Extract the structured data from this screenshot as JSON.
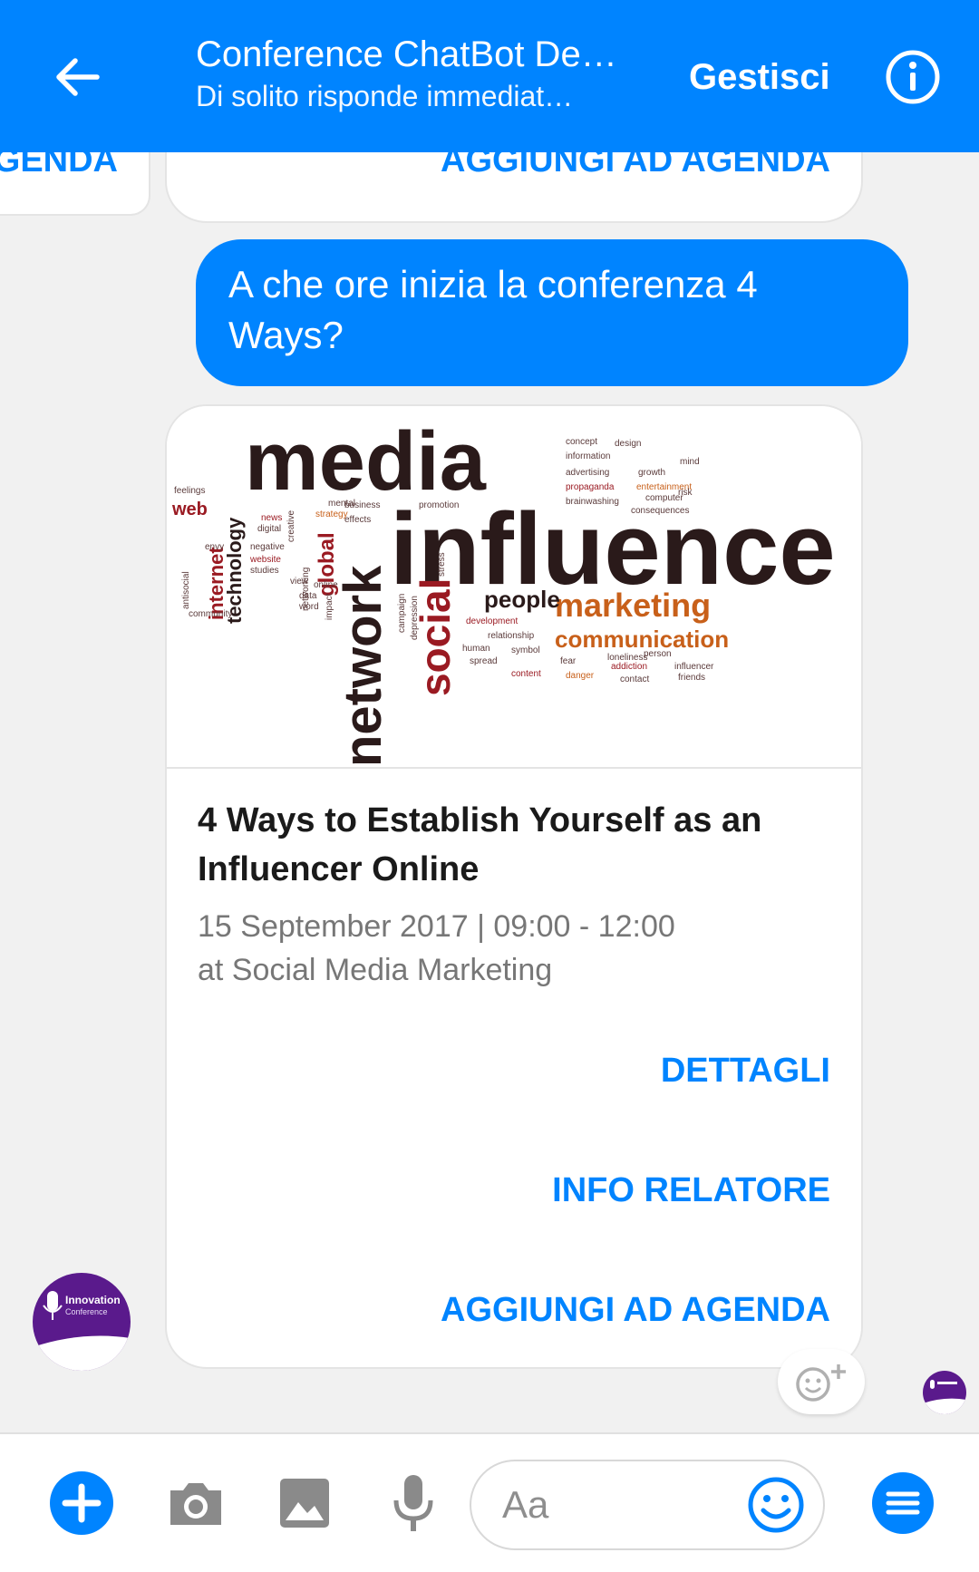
{
  "header": {
    "title": "Conference ChatBot De…",
    "subtitle": "Di solito risponde immediat…",
    "manage_label": "Gestisci"
  },
  "colors": {
    "accent": "#0084ff",
    "avatar_purple": "#5a1a8c"
  },
  "chat": {
    "prev_card_left_button": "GENDA",
    "prev_card_button": "AGGIUNGI AD AGENDA",
    "outgoing_message": "A che ore inizia la conferenza 4 Ways?",
    "card": {
      "image_words": {
        "main": [
          "media",
          "influence",
          "network",
          "social",
          "marketing",
          "communication",
          "people",
          "global",
          "internet",
          "technology",
          "web"
        ],
        "small": [
          "concept",
          "design",
          "information",
          "advertising",
          "growth",
          "propaganda",
          "entertainment",
          "brainwashing",
          "computer",
          "consequences",
          "business",
          "promotion",
          "strategy",
          "feelings",
          "digital",
          "news",
          "negative",
          "website",
          "studies",
          "data",
          "word",
          "online",
          "community",
          "development",
          "relationship",
          "human",
          "symbol",
          "spread",
          "fear",
          "addiction",
          "influencer",
          "content",
          "danger",
          "contact",
          "friends",
          "mind",
          "risk",
          "loneliness",
          "person",
          "view",
          "envy",
          "antisocial",
          "effects",
          "campaign",
          "depression",
          "stress",
          "impact",
          "creative",
          "mental",
          "networking"
        ]
      },
      "title": "4 Ways to Establish Yourself as an Influencer Online",
      "date_line": "15 September 2017 | 09:00 - 12:00",
      "location_line": "at Social Media Marketing",
      "buttons": [
        "DETTAGLI",
        "INFO RELATORE",
        "AGGIUNGI AD AGENDA"
      ]
    },
    "avatar_text": {
      "name": "Innovation",
      "tagline": "Conference"
    }
  },
  "composer": {
    "placeholder": "Aa"
  },
  "icons": {
    "back": "arrow-left-icon",
    "info": "info-icon",
    "add": "plus-icon",
    "camera": "camera-icon",
    "gallery": "image-icon",
    "mic": "microphone-icon",
    "emoji": "smiley-icon",
    "menu": "menu-icon",
    "reaction": "add-reaction-icon"
  }
}
